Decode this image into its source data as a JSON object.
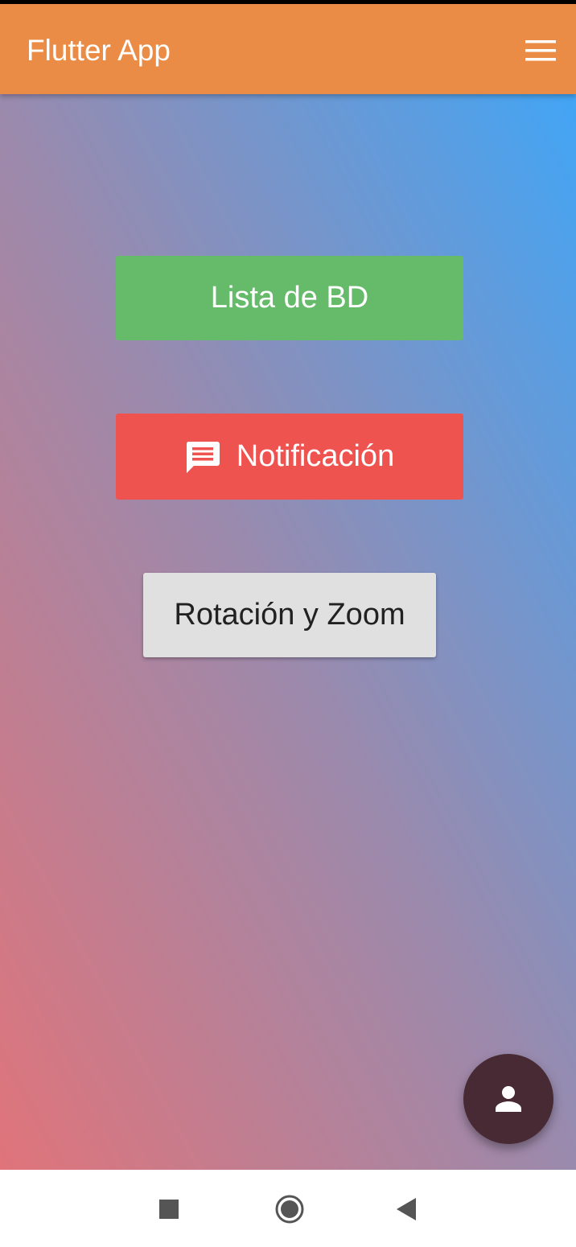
{
  "app_bar": {
    "title": "Flutter App",
    "menu_icon": "hamburger-menu-icon",
    "background": "#eb8c46"
  },
  "buttons": {
    "lista_bd": "Lista de BD",
    "notificacion": "Notificación",
    "notificacion_icon": "message-icon",
    "rotacion_zoom": "Rotación y Zoom"
  },
  "fab": {
    "icon": "person-icon"
  },
  "colors": {
    "green_button": "#66bb6a",
    "red_button": "#ef5350",
    "grey_button": "#e0e0e0",
    "fab": "#472a33",
    "gradient_top": "#42a5f5",
    "gradient_bottom": "#e0747a"
  },
  "nav_bar": {
    "icons": [
      "recents-square-icon",
      "home-circle-icon",
      "back-triangle-icon"
    ]
  }
}
